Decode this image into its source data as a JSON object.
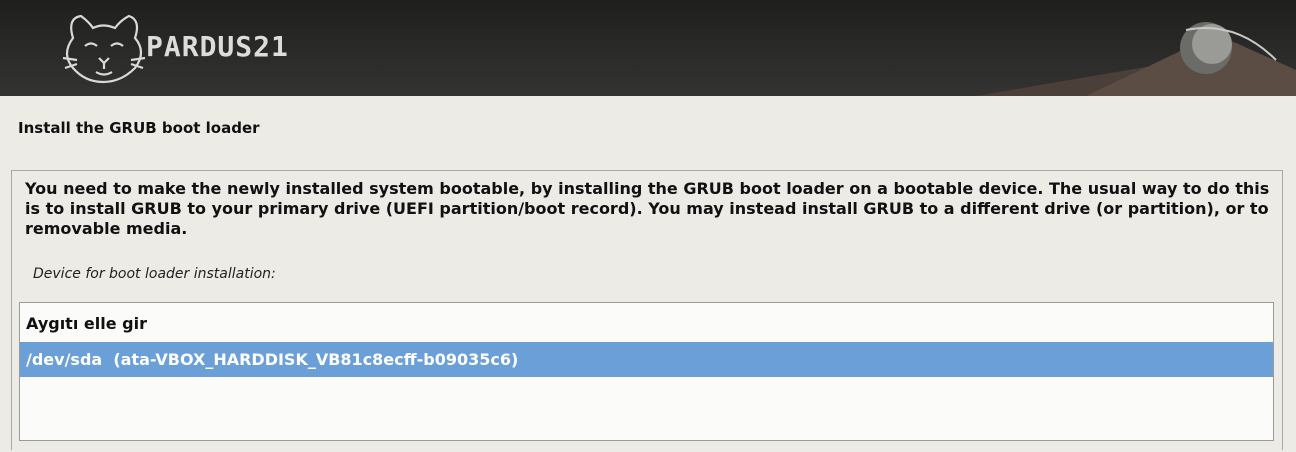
{
  "banner": {
    "logo_text": "PARDUS21"
  },
  "page": {
    "title": "Install the GRUB boot loader"
  },
  "content": {
    "description": "You need to make the newly installed system bootable, by installing the GRUB boot loader on a bootable device. The usual way to do this is to install GRUB to your primary drive (UEFI partition/boot record). You may instead install GRUB to a different drive (or partition), or to removable media.",
    "prompt": "Device for boot loader installation:"
  },
  "device_list": {
    "options": [
      {
        "label": "Aygıtı elle gir",
        "selected": false
      },
      {
        "label": "/dev/sda  (ata-VBOX_HARDDISK_VB81c8ecff-b09035c6)",
        "selected": true
      }
    ]
  },
  "colors": {
    "banner_bg": "#2b2b2a",
    "page_bg": "#ecebe6",
    "selection": "#6a9fd8",
    "list_bg": "#fbfbfa"
  }
}
